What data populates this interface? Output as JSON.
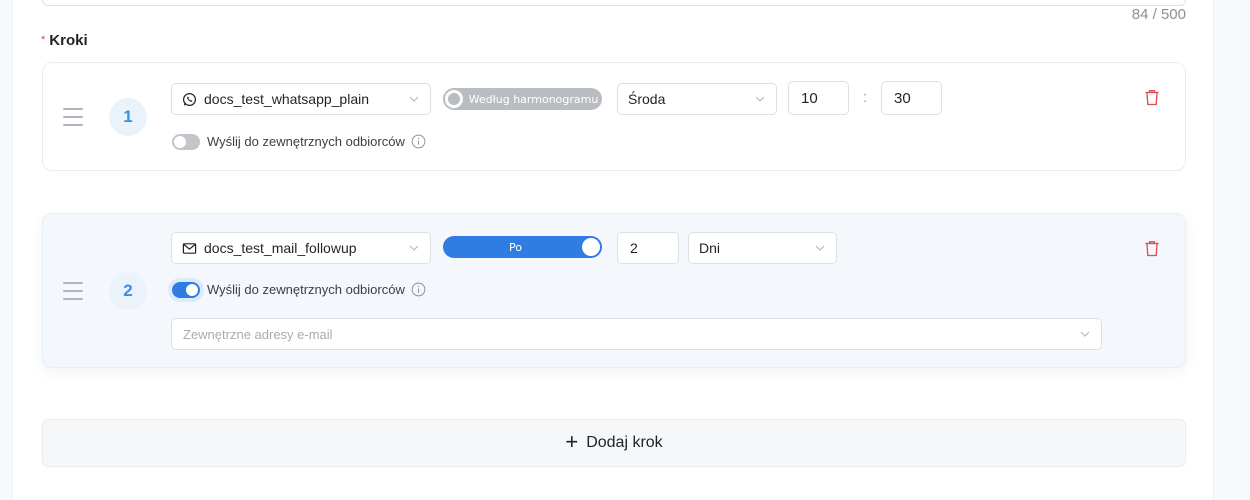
{
  "description_field": {
    "char_count": "84 / 500"
  },
  "steps_section": {
    "required_mark": "*",
    "label": "Kroki"
  },
  "steps": [
    {
      "number": "1",
      "template": {
        "icon": "whatsapp-icon",
        "value": "docs_test_whatsapp_plain"
      },
      "timing_toggle": {
        "label": "Według harmonogramu",
        "state": "off"
      },
      "day": "Środa",
      "hour": "10",
      "time_separator": ":",
      "minute": "30",
      "external_recipients": {
        "label": "Wyślij do zewnętrznych odbiorców",
        "state": "off"
      }
    },
    {
      "number": "2",
      "template": {
        "icon": "mail-icon",
        "value": "docs_test_mail_followup"
      },
      "timing_toggle": {
        "label": "Po",
        "state": "on"
      },
      "delay_value": "2",
      "delay_unit": "Dni",
      "external_recipients": {
        "label": "Wyślij do zewnętrznych odbiorców",
        "state": "on"
      },
      "external_emails": {
        "placeholder": "Zewnętrzne adresy e-mail"
      }
    }
  ],
  "add_step": {
    "icon": "plus-icon",
    "label": "Dodaj krok"
  },
  "colors": {
    "accent": "#2f7de1",
    "step_number_bg": "#eaf3fc",
    "delete": "#e5484d",
    "toggle_off": "#b9bcc1"
  }
}
